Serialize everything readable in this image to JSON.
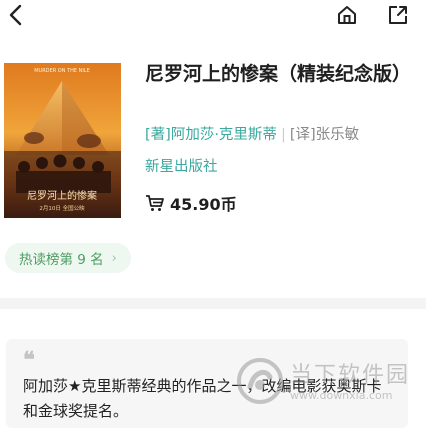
{
  "nav": {
    "back_icon": "chevron-left-icon",
    "home_icon": "home-icon",
    "share_icon": "share-icon"
  },
  "book": {
    "title": "尼罗河上的惨案（精装纪念版）",
    "author_tag": "[著]",
    "author": "阿加莎·克里斯蒂",
    "translator_tag": "[译]",
    "translator": "张乐敏",
    "publisher": "新星出版社",
    "price": "45.90币",
    "cover": {
      "title_text": "尼罗河上的惨案",
      "top_text": "MURDER ON THE NILE",
      "bottom_text": "2月10日 全国公映"
    }
  },
  "rank_badge": {
    "label": "热读榜第 9 名",
    "chevron": "›"
  },
  "quote": {
    "mark": "❝",
    "text": "阿加莎★克里斯蒂经典的作品之一，改编电影获奥斯卡和金球奖提名。"
  },
  "watermark": {
    "title": "当下软件园",
    "url": "www.downxia.com"
  },
  "colors": {
    "accent": "#3aa89e",
    "rank_text": "#4d9e63",
    "rank_bg": "#eef7f0"
  }
}
